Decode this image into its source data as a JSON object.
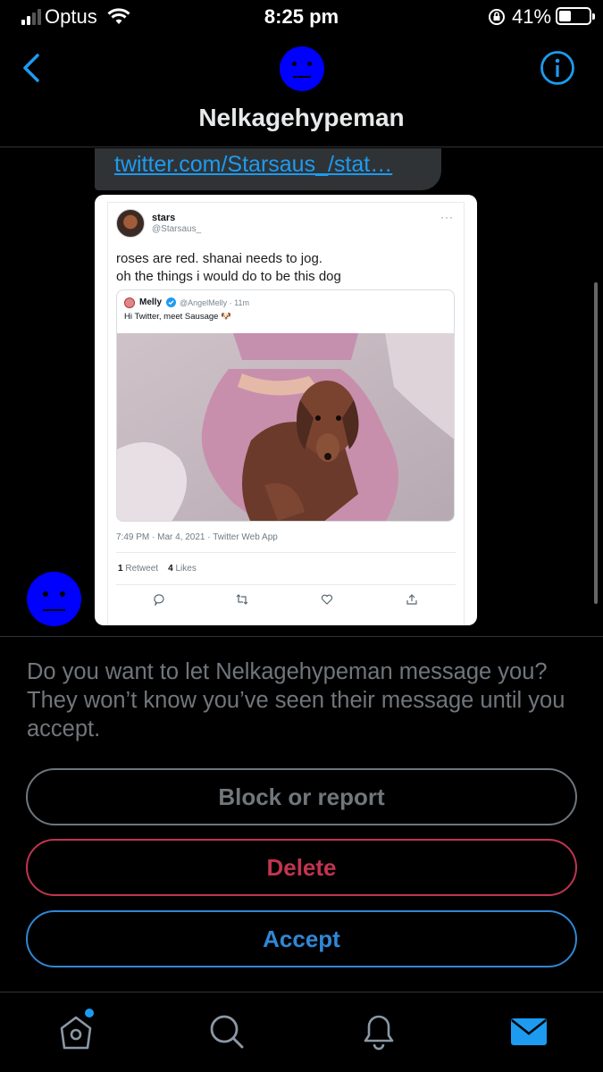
{
  "status_bar": {
    "carrier": "Optus",
    "time": "8:25 pm",
    "battery": "41%"
  },
  "header": {
    "title": "Nelkagehypeman",
    "back_icon": "chevron-left-icon",
    "info_icon": "info-icon",
    "accent_color": "#1d9bf0"
  },
  "conversation": {
    "link_text": "twitter.com/Starsaus_/stat…",
    "tweet": {
      "name": "stars",
      "handle": "@Starsaus_",
      "more": "···",
      "text_line1": "roses are red. shanai needs to jog.",
      "text_line2": "oh the things i would do to be this dog",
      "quote": {
        "name": "Melly",
        "meta": "@AngelMelly · 11m",
        "text": "Hi Twitter, meet Sausage 🐶"
      },
      "timestamp": "7:49 PM · Mar 4, 2021 · Twitter Web App",
      "retweets": "1",
      "retweets_label": "Retweet",
      "likes": "4",
      "likes_label": "Likes"
    }
  },
  "request": {
    "message": "Do you want to let Nelkagehypeman message you? They won’t know you’ve seen their message until you accept."
  },
  "buttons": {
    "block": "Block or report",
    "delete": "Delete",
    "accept": "Accept"
  },
  "tab_bar": {
    "items": [
      "home-icon",
      "search-icon",
      "notifications-bell-icon",
      "messages-mail-icon"
    ],
    "active": "messages-mail-icon"
  }
}
